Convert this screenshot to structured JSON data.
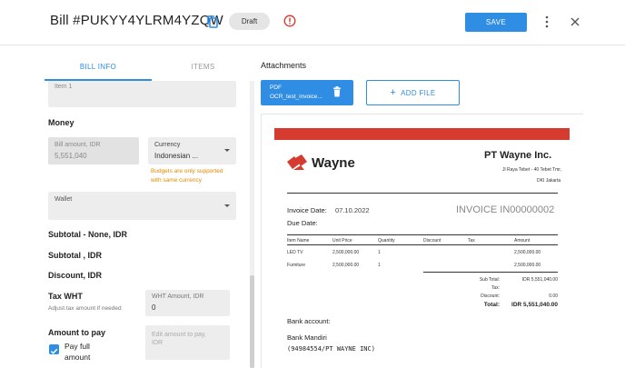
{
  "header": {
    "title": "Bill #PUKYY4YLRM4YZQW",
    "status": "Draft",
    "save_label": "SAVE"
  },
  "tabs": [
    {
      "label": "BILL INFO",
      "active": true
    },
    {
      "label": "ITEMS",
      "active": false
    }
  ],
  "form": {
    "item_label": "Item 1",
    "money_heading": "Money",
    "bill_amount": {
      "label": "Bill amount, IDR",
      "value": "5,551,040"
    },
    "currency": {
      "label": "Currency",
      "value": "Indonesian ..."
    },
    "currency_warning": [
      "Budgets are only supported",
      "with same currency"
    ],
    "wallet": {
      "label": "Wallet"
    },
    "subtotal_none": "Subtotal - None, IDR",
    "subtotal": "Subtotal , IDR",
    "discount": "Discount, IDR",
    "tax_wht": {
      "heading": "Tax WHT",
      "hint": "Adjust tax amount if needed",
      "field_label": "WHT Amount, IDR",
      "field_value": "0"
    },
    "amount_to_pay": {
      "heading": "Amount to pay",
      "checkbox_label": [
        "Pay full",
        "amount"
      ],
      "checked": true,
      "edit_placeholder": [
        "Edit amount to pay,",
        "IDR"
      ]
    }
  },
  "attachments": {
    "title": "Attachments",
    "file": {
      "type": "PDF",
      "name": "OCR_test_invoice..."
    },
    "add_label": "ADD FILE"
  },
  "invoice": {
    "brand": "Wayne",
    "company": "PT Wayne Inc.",
    "address": [
      "Jl Raya Tebet - 40 Tebet Tmr,",
      "DKI Jakarta"
    ],
    "invoice_date_label": "Invoice Date:",
    "invoice_date": "07.10.2022",
    "due_date_label": "Due Date:",
    "invoice_number": "INVOICE IN00000002",
    "columns": [
      "Item Name",
      "Unit Price",
      "Quantity",
      "Discount",
      "Tax",
      "Amount"
    ],
    "rows": [
      [
        "LED TV",
        "2,500,000.00",
        "1",
        "",
        "",
        "2,500,000.00"
      ],
      [
        "Furniture",
        "2,500,000.00",
        "1",
        "",
        "",
        "2,500,000.00"
      ]
    ],
    "summary": [
      {
        "label": "Sub Total:",
        "value": "IDR 5,551,040.00"
      },
      {
        "label": "Tax:",
        "value": ""
      },
      {
        "label": "Discount:",
        "value": "0.00"
      },
      {
        "label": "Total:",
        "value": "IDR 5,551,040.00"
      }
    ],
    "bank_label": "Bank account:",
    "bank_name": "Bank Mandiri",
    "bank_number": "(94984554/PT WAYNE INC)"
  },
  "colors": {
    "accent": "#2f8de4",
    "warning": "#e08a00",
    "brand_red": "#d63b30"
  }
}
